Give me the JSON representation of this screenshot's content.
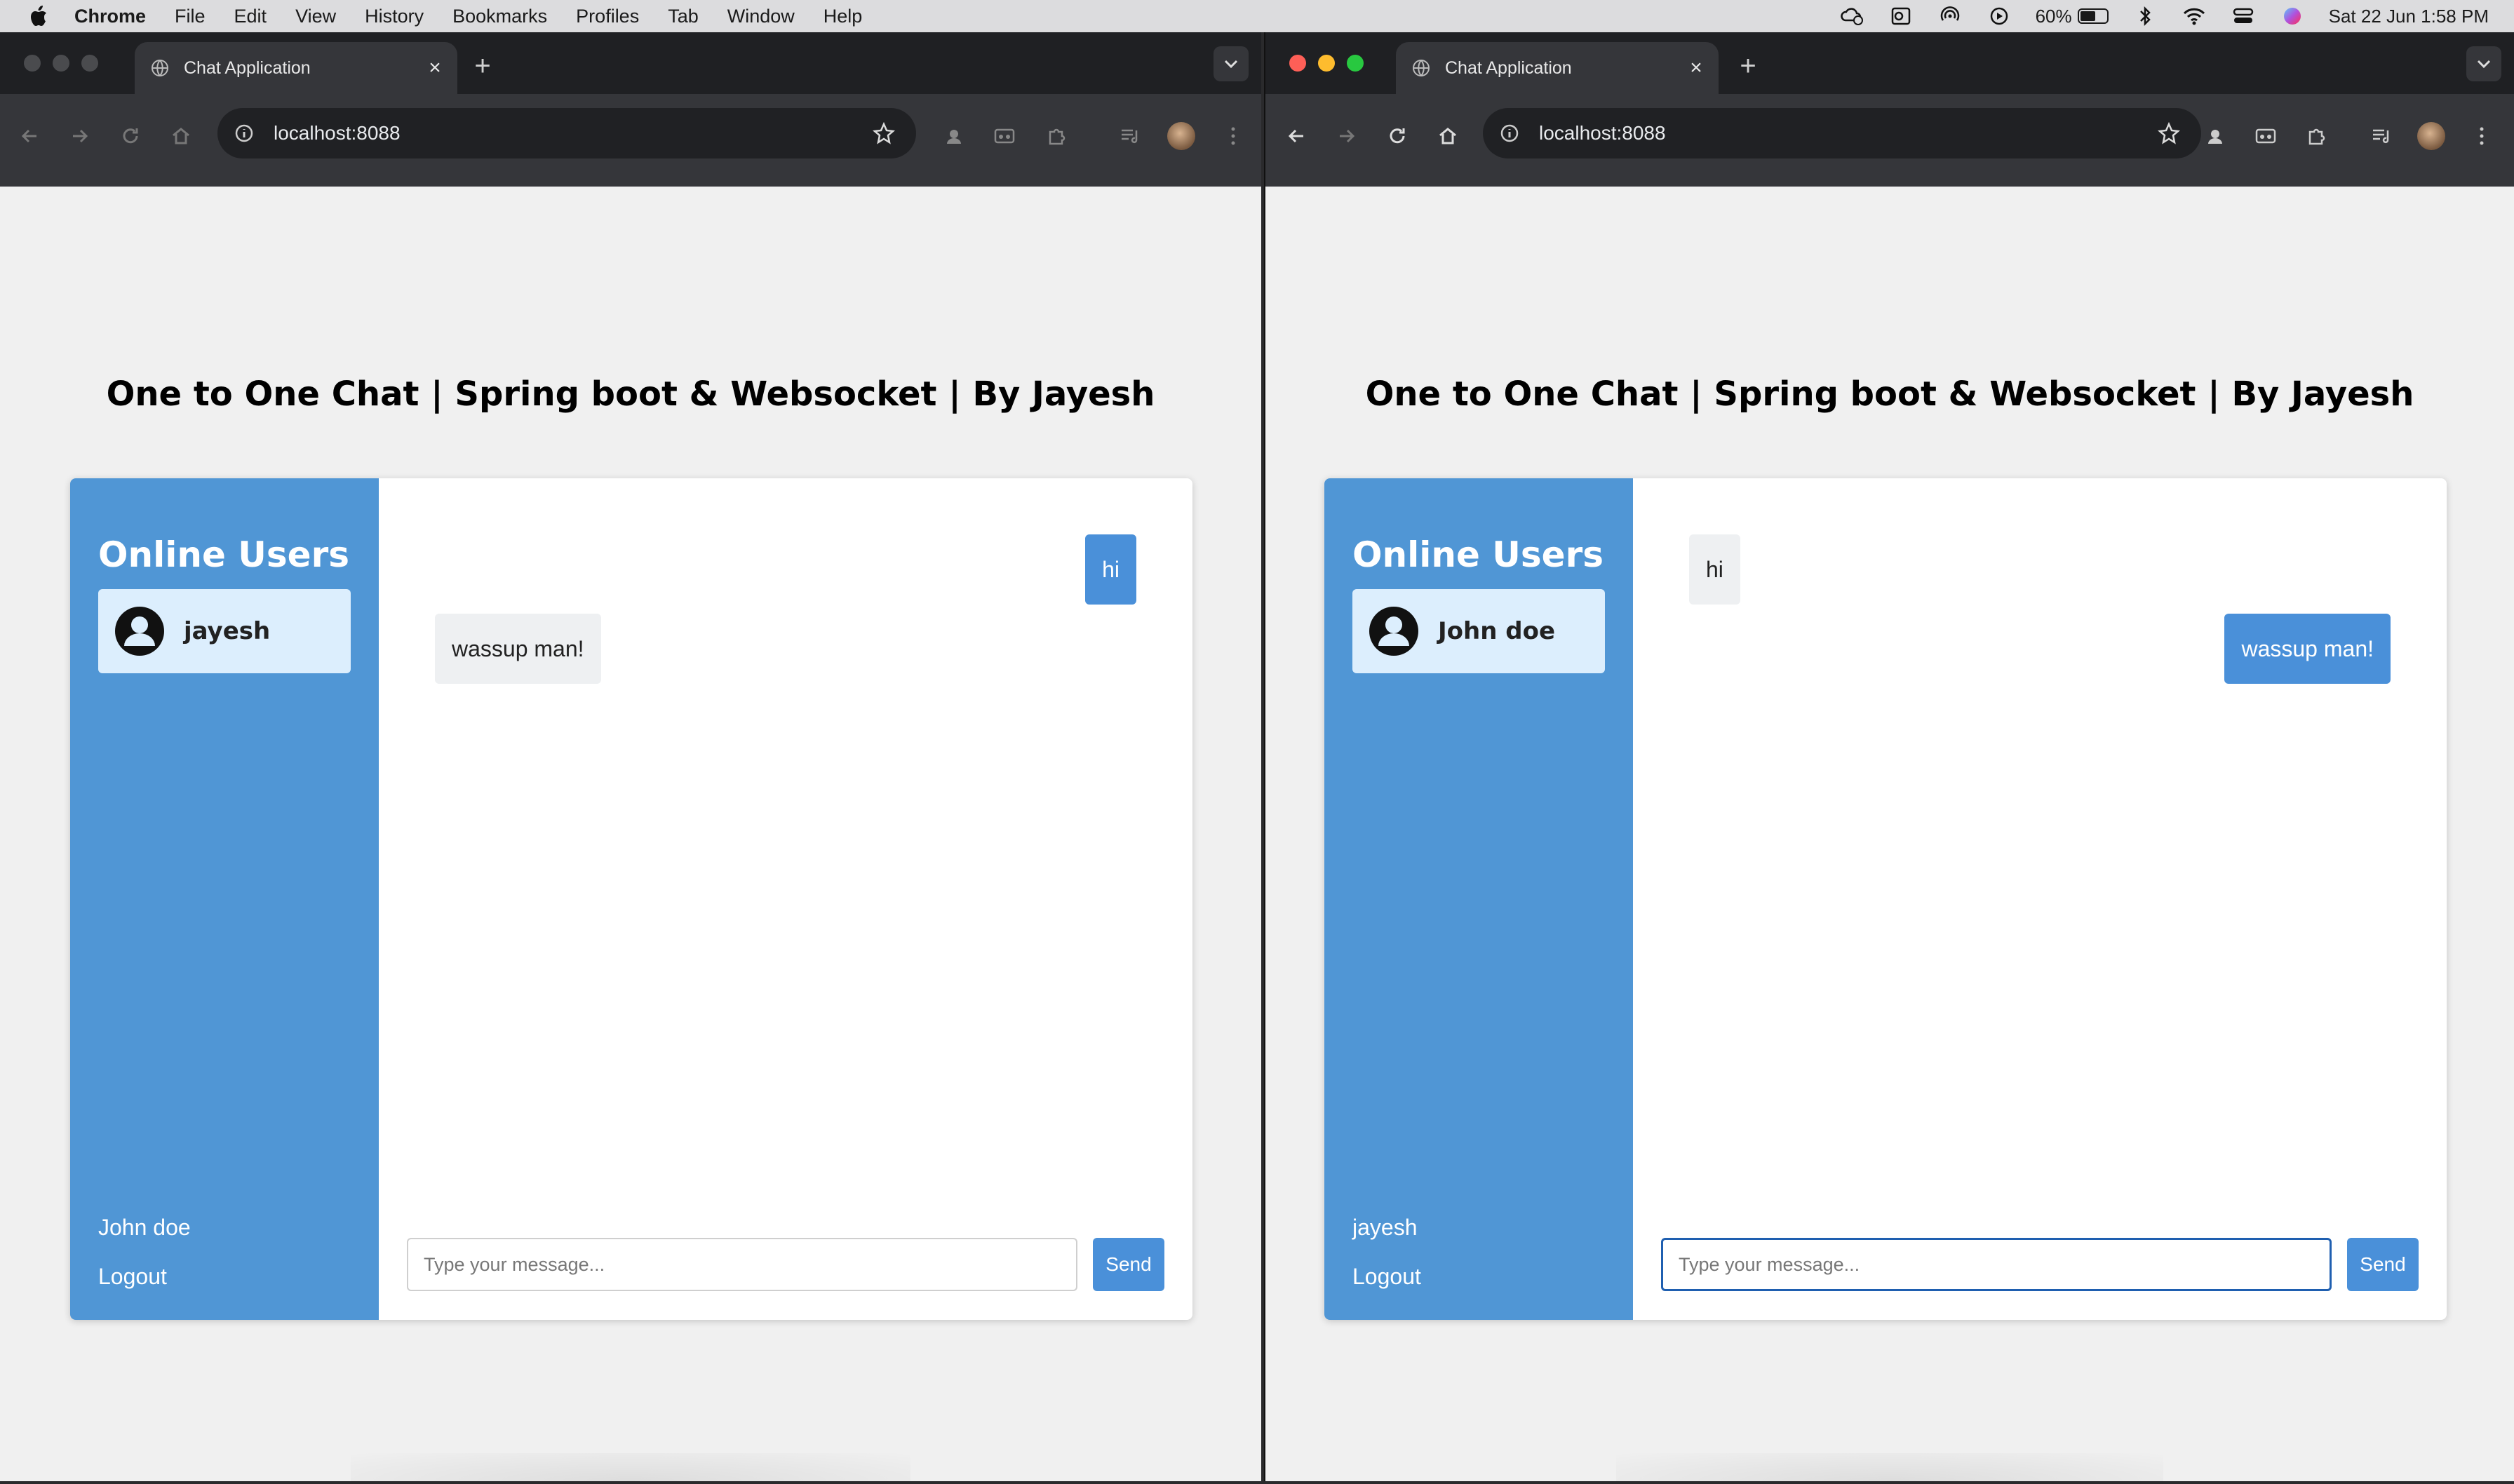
{
  "menubar": {
    "app_name": "Chrome",
    "items": [
      "File",
      "Edit",
      "View",
      "History",
      "Bookmarks",
      "Profiles",
      "Tab",
      "Window",
      "Help"
    ],
    "battery": "60%",
    "datetime": "Sat 22 Jun  1:58 PM"
  },
  "windows": [
    {
      "tab_title": "Chat Application",
      "url": "localhost:8088",
      "page_title": "One to One Chat | Spring boot & Websocket | By Jayesh",
      "sidebar_heading": "Online Users",
      "online_user": "jayesh",
      "current_user": "John doe",
      "logout_label": "Logout",
      "messages": [
        {
          "text": "hi",
          "direction": "sent"
        },
        {
          "text": "wassup man!",
          "direction": "received"
        }
      ],
      "input_placeholder": "Type your message...",
      "send_label": "Send"
    },
    {
      "tab_title": "Chat Application",
      "url": "localhost:8088",
      "page_title": "One to One Chat | Spring boot & Websocket | By Jayesh",
      "sidebar_heading": "Online Users",
      "online_user": "John doe",
      "current_user": "jayesh",
      "logout_label": "Logout",
      "messages": [
        {
          "text": "hi",
          "direction": "received"
        },
        {
          "text": "wassup man!",
          "direction": "sent"
        }
      ],
      "input_placeholder": "Type your message...",
      "send_label": "Send"
    }
  ],
  "colors": {
    "sidebar": "#5096d5",
    "sent_bubble": "#4a90d9",
    "received_bubble": "#eef0f2",
    "active_user_bg": "#dceefd",
    "page_bg": "#f0f0f0"
  }
}
